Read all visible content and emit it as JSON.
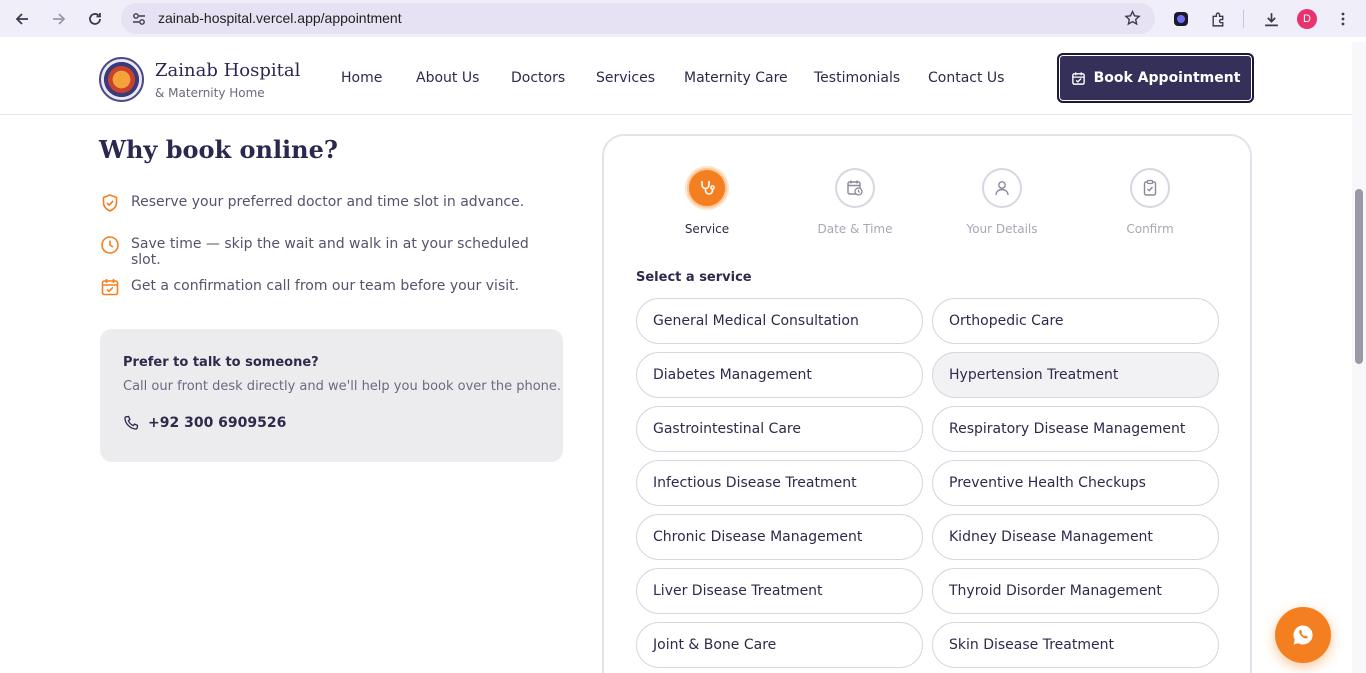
{
  "browser": {
    "url": "zainab-hospital.vercel.app/appointment",
    "profile_initial": "D",
    "icons": [
      "back-icon",
      "forward-icon",
      "reload-icon",
      "site-settings-icon",
      "bookmark-star-icon",
      "extension-icon",
      "puzzle-icon",
      "download-icon",
      "menu-icon"
    ]
  },
  "header": {
    "brand_name": "Zainab Hospital",
    "brand_sub": "& Maternity Home",
    "nav": [
      "Home",
      "About Us",
      "Doctors",
      "Services",
      "Maternity Care",
      "Testimonials",
      "Contact Us"
    ],
    "cta_label": "Book Appointment"
  },
  "left": {
    "title": "Why book online?",
    "benefits": [
      {
        "icon": "shield-check-icon",
        "text": "Reserve your preferred doctor and time slot in advance."
      },
      {
        "icon": "clock-icon",
        "text": "Save time — skip the wait and walk in at your scheduled slot."
      },
      {
        "icon": "calendar-check-icon",
        "text": "Get a confirmation call from our team before your visit."
      }
    ],
    "talk": {
      "title": "Prefer to talk to someone?",
      "desc": "Call our front desk directly and we'll help you book over the phone.",
      "phone": "+92 300 6909526"
    }
  },
  "booking": {
    "steps": [
      {
        "label": "Service",
        "icon": "stethoscope-icon",
        "active": true
      },
      {
        "label": "Date & Time",
        "icon": "calendar-clock-icon",
        "active": false
      },
      {
        "label": "Your Details",
        "icon": "user-icon",
        "active": false
      },
      {
        "label": "Confirm",
        "icon": "clipboard-check-icon",
        "active": false
      }
    ],
    "select_label": "Select a service",
    "services": [
      "General Medical Consultation",
      "Orthopedic Care",
      "Diabetes Management",
      "Hypertension Treatment",
      "Gastrointestinal Care",
      "Respiratory Disease Management",
      "Infectious Disease Treatment",
      "Preventive Health Checkups",
      "Chronic Disease Management",
      "Kidney Disease Management",
      "Liver Disease Treatment",
      "Thyroid Disorder Management",
      "Joint & Bone Care",
      "Skin Disease Treatment"
    ]
  },
  "colors": {
    "accent": "#f47f20",
    "primary": "#35305a",
    "card_bg": "#ececef",
    "border": "#d8d6e0"
  }
}
